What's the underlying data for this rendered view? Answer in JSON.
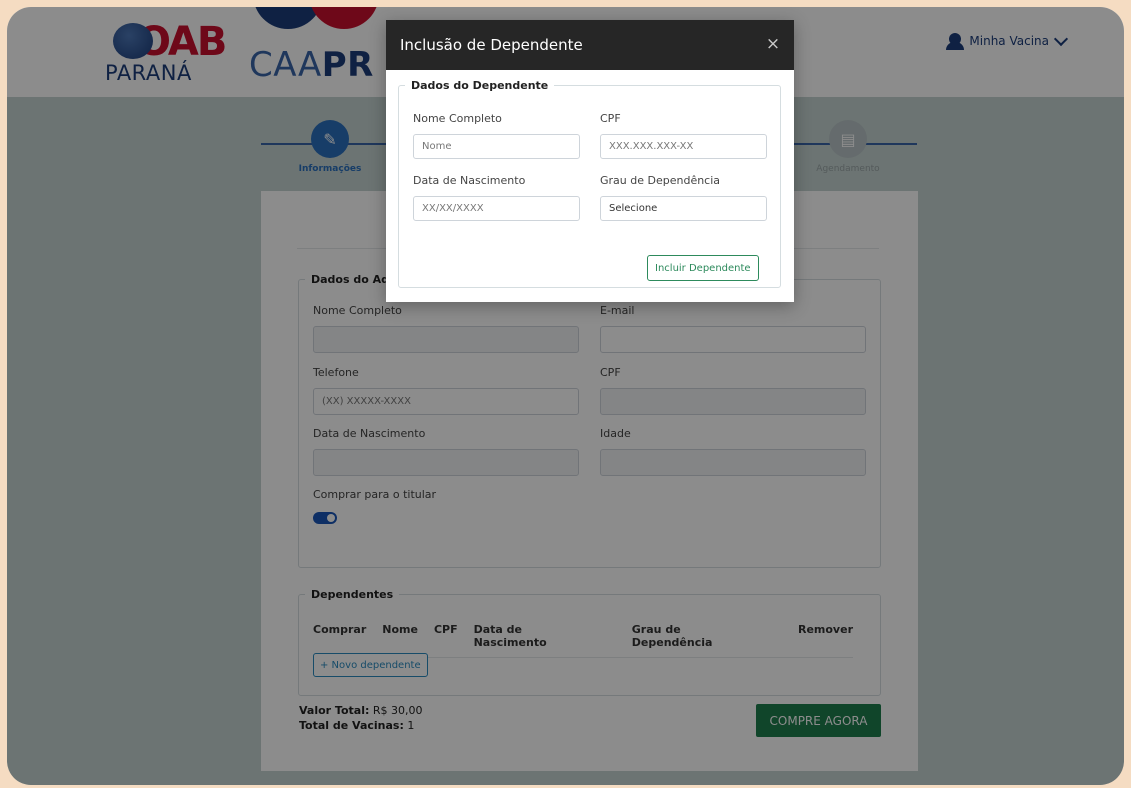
{
  "header": {
    "oab_logo": "OAB",
    "oab_sub": "PARANÁ",
    "caa_logo_a": "CAA",
    "caa_logo_b": "PR",
    "user_menu": "Minha Vacina"
  },
  "stepper": {
    "steps": [
      {
        "label": "Informações",
        "active": true
      },
      {
        "label": "Agendamento",
        "active": false
      }
    ]
  },
  "form": {
    "advogado_legend": "Dados do Advogado",
    "nome_label": "Nome Completo",
    "email_label": "E-mail",
    "telefone_label": "Telefone",
    "telefone_placeholder": "(XX) XXXXX-XXXX",
    "cpf_label": "CPF",
    "nascimento_label": "Data de Nascimento",
    "idade_label": "Idade",
    "comprar_titular_label": "Comprar para o titular",
    "comprar_titular_on": true,
    "dependentes_legend": "Dependentes",
    "dep_columns": [
      "Comprar",
      "Nome",
      "CPF",
      "Data de Nascimento",
      "Grau de Dependência",
      "Remover"
    ],
    "novo_dependente": "+ Novo dependente",
    "valor_total_label": "Valor Total:",
    "valor_total": "R$ 30,00",
    "total_vacinas_label": "Total de Vacinas:",
    "total_vacinas": "1",
    "buy_button": "COMPRE AGORA"
  },
  "modal": {
    "title": "Inclusão de Dependente",
    "close": "×",
    "legend": "Dados do Dependente",
    "nome_label": "Nome Completo",
    "nome_placeholder": "Nome",
    "cpf_label": "CPF",
    "cpf_placeholder": "XXX.XXX.XXX-XX",
    "nascimento_label": "Data de Nascimento",
    "nascimento_placeholder": "XX/XX/XXXX",
    "grau_label": "Grau de Dependência",
    "grau_value": "Selecione",
    "incluir_button": "Incluir Dependente"
  },
  "colors": {
    "accent_blue": "#2a6fbd",
    "brand_navy": "#1c3d7a",
    "brand_red": "#c8102e",
    "buy_green": "#1e7e4e",
    "modal_header": "#262626"
  }
}
